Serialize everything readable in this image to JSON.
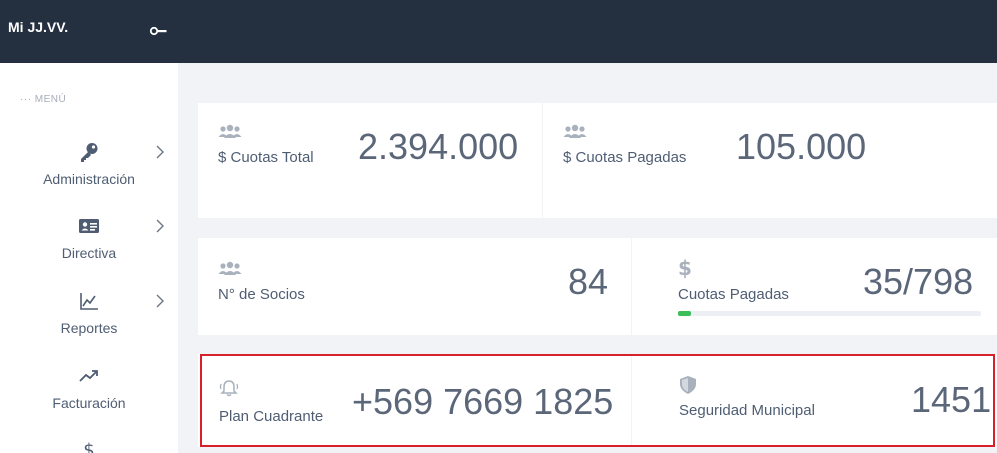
{
  "brand": {
    "title": "Mi JJ.VV.",
    "toggle_icon": "key-toggle-icon"
  },
  "sidebar": {
    "menu_label": "··· MENÚ",
    "items": [
      {
        "label": "Administración",
        "icon": "key-icon",
        "has_submenu": true
      },
      {
        "label": "Directiva",
        "icon": "id-card-icon",
        "has_submenu": true
      },
      {
        "label": "Reportes",
        "icon": "line-chart-icon",
        "has_submenu": true
      },
      {
        "label": "Facturación",
        "icon": "trend-up-icon",
        "has_submenu": false
      },
      {
        "label": "",
        "icon": "dollar-icon",
        "has_submenu": false
      }
    ]
  },
  "stats": {
    "cuotas_total": {
      "label": "$ Cuotas Total",
      "value": "2.394.000",
      "icon": "users-icon"
    },
    "cuotas_pagadas_monto": {
      "label": "$ Cuotas Pagadas",
      "value": "105.000",
      "icon": "users-icon"
    },
    "socios": {
      "label": "N° de Socios",
      "value": "84",
      "icon": "users-icon"
    },
    "cuotas_pagadas": {
      "label": "Cuotas Pagadas",
      "value": "35/798",
      "icon": "dollar-icon",
      "progress": 0.044,
      "progress_color": "#3cbf59"
    },
    "plan_cuadrante": {
      "label": "Plan Cuadrante",
      "value": "+569 7669 1825",
      "icon": "bell-icon"
    },
    "seguridad_municipal": {
      "label": "Seguridad Municipal",
      "value": "1451",
      "icon": "shield-icon"
    }
  },
  "colors": {
    "header_bg": "#243040",
    "highlight": "#d8202b"
  }
}
